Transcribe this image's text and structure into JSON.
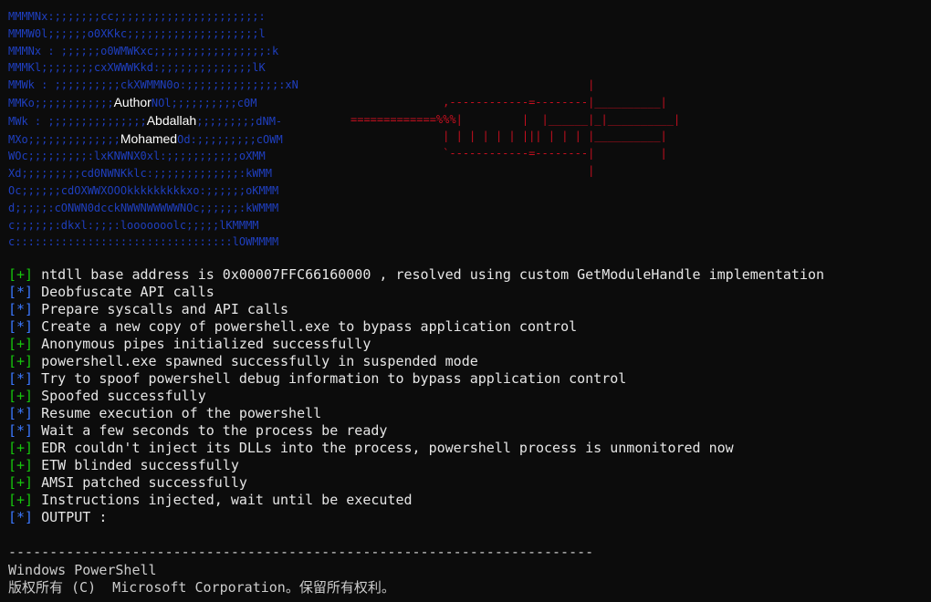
{
  "banner": {
    "left_lines": [
      "MMMMNx:;;;;;;;cc;;;;;;;;;;;;;;;;;;;;;;:",
      "MMMW0l;;;;;;o0XKkc;;;;;;;;;;;;;;;;;;;;l",
      "MMMNx : ;;;;;;o0WMWKxc;;;;;;;;;;;;;;;;;:k",
      "MMMKl;;;;;;;;cxXWWWKkd:;;;;;;;;;;;;;;lK",
      "MMWk : ;;;;;;;;;;ckXWMMN0o:;;;;;;;;;;;;;;:xN",
      "MMKo;;;;;;;;;;;;",
      "MWk : ;;;;;;;;;;;;;;;",
      "MXo;;;;;;;;;;;;;;",
      "WOc;;;;;;;;;:lxKNWNX0xl:;;;;;;;;;;;oXMM",
      "Xd;;;;;;;;;cd0NWNKklc:;;;;;;;;;;;;;:kWMM",
      "Oc;;;;;;cdOXWWXOOOkkkkkkkkkxo:;;;;;;oKMMM",
      "d;;;;;:cONWN0dcckNWWNWWWWWNOc;;;;;;:kWMMM",
      "c;;;;;;:dkxl:;;;:looooooolc;;;;;lKMMMM",
      "c:::::::::::::::::::::::::::::::::lOWMMMM"
    ],
    "line6_tail": "NOl;;;;;;;;;;c0M",
    "line7_tail": ";;;;;;;;;dNM-",
    "line8_tail": "Od:;;;;;;;;;cOWM",
    "author_word": "Author",
    "first_name": "Abdallah",
    "last_name": "Mohamed",
    "right_lines": [
      "                                    |",
      "              ,------------=--------|__________|",
      "=============%%%|         |  |______|_|__________|",
      "              | | | | | | ||| | | | |__________|",
      "              `------------=--------|          |",
      "                                    |"
    ]
  },
  "log": [
    {
      "bracket": "[+]",
      "kind": "plus",
      "text": "ntdll base address is 0x00007FFC66160000 , resolved using custom GetModuleHandle implementation"
    },
    {
      "bracket": "[*]",
      "kind": "star",
      "text": "Deobfuscate API calls"
    },
    {
      "bracket": "[*]",
      "kind": "star",
      "text": "Prepare syscalls and API calls"
    },
    {
      "bracket": "[*]",
      "kind": "star",
      "text": "Create a new copy of powershell.exe to bypass application control"
    },
    {
      "bracket": "[+]",
      "kind": "plus",
      "text": "Anonymous pipes initialized successfully"
    },
    {
      "bracket": "[+]",
      "kind": "plus",
      "text": "powershell.exe spawned successfully in suspended mode"
    },
    {
      "bracket": "[*]",
      "kind": "star",
      "text": "Try to spoof powershell debug information to bypass application control"
    },
    {
      "bracket": "[+]",
      "kind": "plus",
      "text": "Spoofed successfully"
    },
    {
      "bracket": "[*]",
      "kind": "star",
      "text": "Resume execution of the powershell"
    },
    {
      "bracket": "[*]",
      "kind": "star",
      "text": "Wait a few seconds to the process be ready"
    },
    {
      "bracket": "[+]",
      "kind": "plus",
      "text": "EDR couldn't inject its DLLs into the process, powershell process is unmonitored now"
    },
    {
      "bracket": "[+]",
      "kind": "plus",
      "text": "ETW blinded successfully"
    },
    {
      "bracket": "[+]",
      "kind": "plus",
      "text": "AMSI patched successfully"
    },
    {
      "bracket": "[+]",
      "kind": "plus",
      "text": "Instructions injected, wait until be executed"
    },
    {
      "bracket": "[*]",
      "kind": "star",
      "text": "OUTPUT :"
    }
  ],
  "separator": "-----------------------------------------------------------------------",
  "powershell": {
    "title": "Windows PowerShell",
    "copyright": "版权所有 (C)  Microsoft Corporation。保留所有权利。"
  },
  "colors": {
    "background": "#0c0c0c",
    "banner_blue": "#1f3fbf",
    "banner_red": "#c50f1f",
    "plus_green": "#16c60c",
    "star_blue": "#3b78ff"
  }
}
